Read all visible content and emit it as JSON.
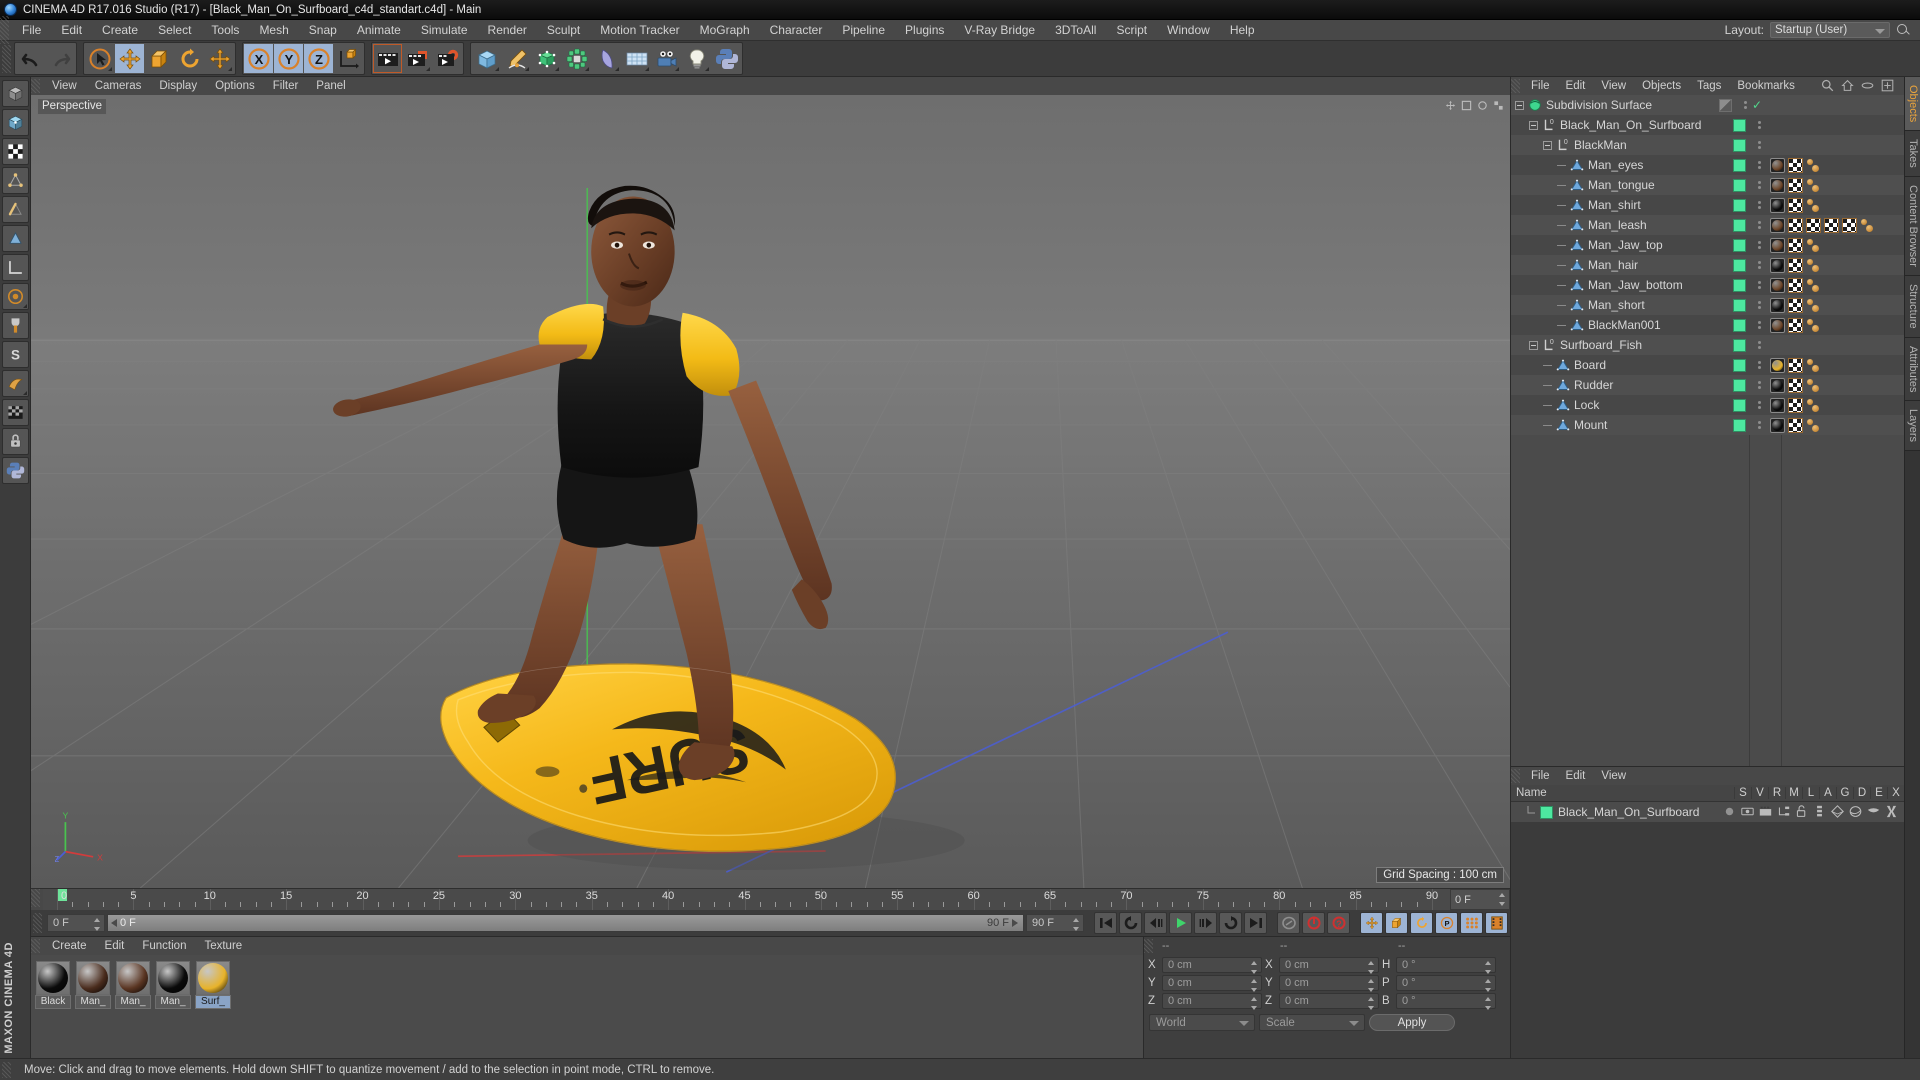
{
  "window": {
    "title": "CINEMA 4D R17.016 Studio (R17) - [Black_Man_On_Surfboard_c4d_standart.c4d] - Main",
    "logo_icon": "cinema4d-logo-icon"
  },
  "menubar": {
    "items": [
      "File",
      "Edit",
      "Create",
      "Select",
      "Tools",
      "Mesh",
      "Snap",
      "Animate",
      "Simulate",
      "Render",
      "Sculpt",
      "Motion Tracker",
      "MoGraph",
      "Character",
      "Pipeline",
      "Plugins",
      "V-Ray Bridge",
      "3DToAll",
      "Script",
      "Window",
      "Help"
    ],
    "layout_label": "Layout:",
    "layout_value": "Startup (User)",
    "search_icon": "search-icon"
  },
  "toolbar": {
    "groups": [
      {
        "name": "history",
        "buttons": [
          {
            "icon": "undo-icon",
            "label": "Undo",
            "state": "normal"
          },
          {
            "icon": "redo-icon",
            "label": "Redo",
            "state": "disabled"
          }
        ]
      },
      {
        "name": "transform",
        "buttons": [
          {
            "icon": "select-cursor-icon",
            "label": "Live Selection",
            "state": "normal"
          },
          {
            "icon": "move-icon",
            "label": "Move",
            "state": "selected"
          },
          {
            "icon": "scale-icon",
            "label": "Scale",
            "state": "normal"
          },
          {
            "icon": "rotate-icon",
            "label": "Rotate",
            "state": "normal"
          },
          {
            "icon": "move-alt-icon",
            "label": "Move Tool",
            "state": "normal"
          }
        ]
      },
      {
        "name": "axes",
        "buttons": [
          {
            "icon": "axis-x-icon",
            "label": "X",
            "state": "selected"
          },
          {
            "icon": "axis-y-icon",
            "label": "Y",
            "state": "selected"
          },
          {
            "icon": "axis-z-icon",
            "label": "Z",
            "state": "selected"
          },
          {
            "icon": "world-coord-icon",
            "label": "World / Object Coordinate System",
            "state": "normal"
          }
        ]
      },
      {
        "name": "render",
        "buttons": [
          {
            "icon": "render-view-icon",
            "label": "Render View",
            "state": "framed"
          },
          {
            "icon": "render-region-icon",
            "label": "Render to Picture Viewer",
            "state": "normal"
          },
          {
            "icon": "render-settings-icon",
            "label": "Edit Render Settings",
            "state": "normal"
          }
        ]
      },
      {
        "name": "create",
        "buttons": [
          {
            "icon": "cube-primitive-icon",
            "label": "Cube",
            "state": "normal"
          },
          {
            "icon": "spline-pen-icon",
            "label": "Pen / Spline",
            "state": "normal"
          },
          {
            "icon": "array-generator-icon",
            "label": "Array",
            "state": "normal"
          },
          {
            "icon": "mograph-cloner-icon",
            "label": "Subdivision Surface",
            "state": "normal"
          },
          {
            "icon": "bend-deformer-icon",
            "label": "Bend Deformer",
            "state": "normal"
          },
          {
            "icon": "floor-environment-icon",
            "label": "Floor / Environment",
            "state": "normal"
          },
          {
            "icon": "camera-icon",
            "label": "Camera",
            "state": "normal"
          },
          {
            "icon": "light-bulb-icon",
            "label": "Light",
            "state": "normal"
          },
          {
            "icon": "python-icon",
            "label": "Python Generator",
            "state": "normal"
          }
        ]
      }
    ]
  },
  "lefttoolbar": {
    "buttons": [
      {
        "icon": "cube-mode-icon",
        "label": "Make Editable"
      },
      {
        "icon": "model-mode-icon",
        "label": "Model Mode"
      },
      {
        "icon": "texture-mode-icon",
        "label": "Texture Mode"
      },
      {
        "icon": "points-mode-icon",
        "label": "Points Mode"
      },
      {
        "icon": "edges-mode-icon",
        "label": "Edges Mode"
      },
      {
        "icon": "polygons-mode-icon",
        "label": "Polygons Mode"
      },
      {
        "icon": "axis-mode-icon",
        "label": "Enable Axis Modification"
      },
      {
        "icon": "viewport-solo-icon",
        "label": "Viewport Solo Single"
      },
      {
        "icon": "snap-icon",
        "label": "Enable Snap"
      },
      {
        "icon": "workplane-icon",
        "label": "Workplane"
      },
      {
        "icon": "lock-icon",
        "label": "Lock Workplane"
      },
      {
        "icon": "planar-icon",
        "label": "Planar Workplane"
      }
    ],
    "brand": "MAXON CINEMA 4D"
  },
  "viewport": {
    "menu": [
      "View",
      "Cameras",
      "Display",
      "Options",
      "Filter",
      "Panel"
    ],
    "label": "Perspective",
    "grid_spacing": "Grid Spacing : 100 cm",
    "axis_labels": {
      "y": "Y",
      "x": "X",
      "z": "Z"
    }
  },
  "timeline": {
    "current_frame_field": "0 F",
    "ticks": [
      0,
      5,
      10,
      15,
      20,
      25,
      30,
      35,
      40,
      45,
      50,
      55,
      60,
      65,
      70,
      75,
      80,
      85,
      90
    ],
    "min_frame": "0 F",
    "preview_min": "0 F",
    "preview_max": "90 F",
    "max_frame": "90 F",
    "right_frame_field": "0 F",
    "transport": [
      {
        "icon": "go-to-start-icon",
        "label": "Go to Start"
      },
      {
        "icon": "play-back-loop-icon",
        "label": "Play Backwards"
      },
      {
        "icon": "step-back-icon",
        "label": "Go to Previous Frame"
      },
      {
        "icon": "play-forward-icon",
        "label": "Play Forwards"
      },
      {
        "icon": "step-forward-icon",
        "label": "Go to Next Frame"
      },
      {
        "icon": "loop-icon",
        "label": "Loop"
      },
      {
        "icon": "go-to-end-icon",
        "label": "Go to End"
      },
      {
        "icon": "record-key-icon",
        "label": "Record Active Objects"
      },
      {
        "icon": "autokey-icon",
        "label": "Autokeying"
      },
      {
        "icon": "keyframe-selection-icon",
        "label": "Keyframe Selection"
      },
      {
        "icon": "position-key-icon",
        "label": "Position"
      },
      {
        "icon": "scale-key-icon",
        "label": "Scale"
      },
      {
        "icon": "rotation-key-icon",
        "label": "Rotation"
      },
      {
        "icon": "parameter-key-icon",
        "label": "Parameter"
      },
      {
        "icon": "point-level-anim-icon",
        "label": "Point Level Animation"
      },
      {
        "icon": "timeline-icon",
        "label": "Timeline"
      }
    ]
  },
  "materials": {
    "menu": [
      "Create",
      "Edit",
      "Function",
      "Texture"
    ],
    "items": [
      {
        "name": "Black",
        "color": "#0b0b0b",
        "selected": false
      },
      {
        "name": "Man_",
        "color": "#4a2c1d",
        "selected": false
      },
      {
        "name": "Man_",
        "color": "#5a3522",
        "selected": false
      },
      {
        "name": "Man_",
        "color": "#0a0a0a",
        "selected": false
      },
      {
        "name": "Surf_",
        "color": "#e8b32a",
        "selected": true
      }
    ]
  },
  "coordinates": {
    "header_dashes": [
      "--",
      "--",
      "--"
    ],
    "position": {
      "label_x": "X",
      "label_y": "Y",
      "label_z": "Z",
      "x": "0 cm",
      "y": "0 cm",
      "z": "0 cm"
    },
    "size": {
      "label_x": "X",
      "label_y": "Y",
      "label_z": "Z",
      "x": "0 cm",
      "y": "0 cm",
      "z": "0 cm"
    },
    "rotation": {
      "label_h": "H",
      "label_p": "P",
      "label_b": "B",
      "h": "0 °",
      "p": "0 °",
      "b": "0 °"
    },
    "coord_system": "World",
    "transform_mode": "Scale",
    "apply_label": "Apply"
  },
  "object_manager": {
    "menu": [
      "File",
      "Edit",
      "View",
      "Objects",
      "Tags",
      "Bookmarks"
    ],
    "header_icons": [
      "search-icon",
      "home-icon",
      "ellipse-icon",
      "new-layer-icon"
    ],
    "rows": [
      {
        "label": "Subdivision Surface",
        "depth": 0,
        "icon": "subdivision-surface-icon",
        "expander": true,
        "visibility": "checker",
        "check": true,
        "tags": []
      },
      {
        "label": "Black_Man_On_Surfboard",
        "depth": 1,
        "icon": "null-layer-icon",
        "expander": true,
        "visibility": "green",
        "tags": []
      },
      {
        "label": "BlackMan",
        "depth": 2,
        "icon": "null-layer-icon",
        "expander": true,
        "visibility": "green",
        "tags": []
      },
      {
        "label": "Man_eyes",
        "depth": 3,
        "icon": "polygon-object-icon",
        "expander": false,
        "visibility": "green",
        "tags": [
          "material-brown",
          "uvw-checker",
          "dots"
        ]
      },
      {
        "label": "Man_tongue",
        "depth": 3,
        "icon": "polygon-object-icon",
        "expander": false,
        "visibility": "green",
        "tags": [
          "material-brown",
          "uvw-checker",
          "dots"
        ]
      },
      {
        "label": "Man_shirt",
        "depth": 3,
        "icon": "polygon-object-icon",
        "expander": false,
        "visibility": "green",
        "tags": [
          "material-black",
          "uvw-checker",
          "dots"
        ]
      },
      {
        "label": "Man_leash",
        "depth": 3,
        "icon": "polygon-object-icon",
        "expander": false,
        "visibility": "green",
        "tags": [
          "material-brown",
          "uvw-checker",
          "uvw-checker",
          "uvw-checker",
          "uvw-checker",
          "dots"
        ]
      },
      {
        "label": "Man_Jaw_top",
        "depth": 3,
        "icon": "polygon-object-icon",
        "expander": false,
        "visibility": "green",
        "tags": [
          "material-brown",
          "uvw-checker",
          "dots"
        ]
      },
      {
        "label": "Man_hair",
        "depth": 3,
        "icon": "polygon-object-icon",
        "expander": false,
        "visibility": "green",
        "tags": [
          "material-black",
          "uvw-checker",
          "dots"
        ]
      },
      {
        "label": "Man_Jaw_bottom",
        "depth": 3,
        "icon": "polygon-object-icon",
        "expander": false,
        "visibility": "green",
        "tags": [
          "material-brown",
          "uvw-checker",
          "dots"
        ]
      },
      {
        "label": "Man_short",
        "depth": 3,
        "icon": "polygon-object-icon",
        "expander": false,
        "visibility": "green",
        "tags": [
          "material-black",
          "uvw-checker",
          "dots"
        ]
      },
      {
        "label": "BlackMan001",
        "depth": 3,
        "icon": "polygon-object-icon",
        "expander": false,
        "visibility": "green",
        "tags": [
          "material-brown",
          "uvw-checker",
          "dots"
        ]
      },
      {
        "label": "Surfboard_Fish",
        "depth": 1,
        "icon": "null-layer-icon",
        "expander": true,
        "visibility": "green",
        "tags": []
      },
      {
        "label": "Board",
        "depth": 2,
        "icon": "polygon-object-icon",
        "expander": false,
        "visibility": "green",
        "tags": [
          "material-yellow",
          "uvw-checker",
          "dots"
        ]
      },
      {
        "label": "Rudder",
        "depth": 2,
        "icon": "polygon-object-icon",
        "expander": false,
        "visibility": "green",
        "tags": [
          "material-black",
          "uvw-checker",
          "dots"
        ]
      },
      {
        "label": "Lock",
        "depth": 2,
        "icon": "polygon-object-icon",
        "expander": false,
        "visibility": "green",
        "tags": [
          "material-black",
          "uvw-checker",
          "dots"
        ]
      },
      {
        "label": "Mount",
        "depth": 2,
        "icon": "polygon-object-icon",
        "expander": false,
        "visibility": "green",
        "tags": [
          "material-black",
          "uvw-checker",
          "dots"
        ]
      }
    ]
  },
  "attributes_panel": {
    "menu": [
      "File",
      "Edit",
      "View"
    ],
    "columns": [
      "Name",
      "S",
      "V",
      "R",
      "M",
      "L",
      "A",
      "G",
      "D",
      "E",
      "X"
    ],
    "row_label": "Black_Man_On_Surfboard",
    "row_icons": [
      "solo-dot-icon",
      "visible-icon",
      "render-icon",
      "hierarchy-icon",
      "lock-open-icon",
      "animate-icon",
      "generator-icon",
      "deformer-icon",
      "expression-icon",
      "xref-icon"
    ]
  },
  "right_tabs": [
    {
      "label": "Objects",
      "accent": true
    },
    {
      "label": "Takes",
      "accent": false
    },
    {
      "label": "Content Browser",
      "accent": false
    },
    {
      "label": "Structure",
      "accent": false
    },
    {
      "label": "Attributes",
      "accent": false
    },
    {
      "label": "Layers",
      "accent": false
    }
  ],
  "statusbar": {
    "message": "Move: Click and drag to move elements. Hold down SHIFT to quantize movement / add to the selection in point mode, CTRL to remove."
  },
  "colors": {
    "accent_selected": "#9db4d4",
    "green_chip": "#4de8a0",
    "orange_icon": "#e8a33d",
    "board_yellow": "#f0b61f",
    "skin": "#7a4a30",
    "shirt_black": "#141414"
  }
}
